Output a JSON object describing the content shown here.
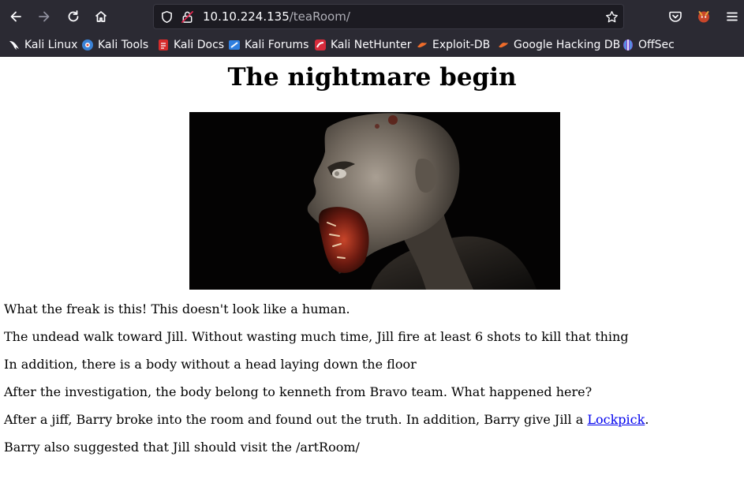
{
  "browser": {
    "url_host": "10.10.224.135",
    "url_path": "/teaRoom/",
    "bookmarks": [
      {
        "label": "Kali Linux",
        "icon": "kali-dragon-icon"
      },
      {
        "label": "Kali Tools",
        "icon": "kali-tools-icon"
      },
      {
        "label": "Kali Docs",
        "icon": "kali-docs-icon"
      },
      {
        "label": "Kali Forums",
        "icon": "kali-forums-icon"
      },
      {
        "label": "Kali NetHunter",
        "icon": "kali-nethunter-icon"
      },
      {
        "label": "Exploit-DB",
        "icon": "exploit-db-icon"
      },
      {
        "label": "Google Hacking DB",
        "icon": "ghdb-icon"
      },
      {
        "label": "OffSec",
        "icon": "offsec-icon"
      }
    ]
  },
  "page": {
    "heading": "The nightmare begin",
    "paragraphs": [
      "What the freak is this! This doesn't look like a human.",
      "The undead walk toward Jill. Without wasting much time, Jill fire at least 6 shots to kill that thing",
      "In addition, there is a body without a head laying down the floor",
      "After the investigation, the body belong to kenneth from Bravo team. What happened here?",
      "Barry also suggested that Jill should visit the /artRoom/"
    ],
    "lockpick_paragraph": {
      "before": "After a jiff, Barry broke into the room and found out the truth. In addition, Barry give Jill a ",
      "link": "Lockpick",
      "after": "."
    }
  }
}
